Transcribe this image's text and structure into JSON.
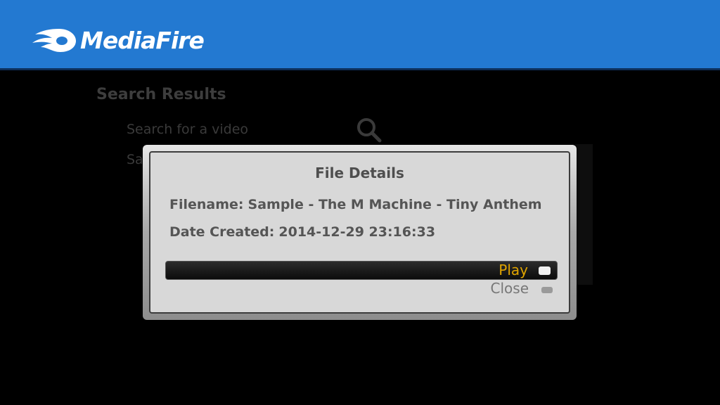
{
  "header": {
    "brand": "MediaFire",
    "logo_icon": "mediafire-flame-icon",
    "background_color": "#2379d1"
  },
  "background": {
    "title": "Search Results",
    "search_placeholder": "Search for a video",
    "search_icon": "search-icon",
    "partial_list_item": "Sa"
  },
  "dialog": {
    "title": "File Details",
    "filename_label": "Filename:",
    "filename_value": "Sample - The M Machine - Tiny Anthem",
    "date_label": "Date Created:",
    "date_value": "2014-12-29 23:16:33",
    "options": [
      {
        "label": "Play",
        "selected": true
      },
      {
        "label": "Close",
        "selected": false
      }
    ],
    "selected_color": "#e0a400"
  }
}
